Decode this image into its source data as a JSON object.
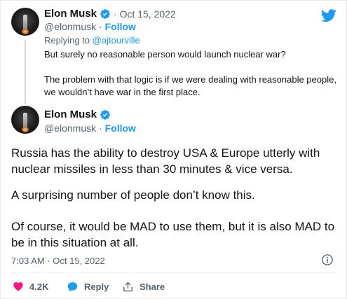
{
  "quoted_tweet": {
    "author_name": "Elon Musk",
    "date_sep": "·",
    "date": "Oct 15, 2022",
    "handle": "@elonmusk",
    "follow_sep": "·",
    "follow_label": "Follow",
    "replying_prefix": "Replying to",
    "replying_to": "@ajtourville",
    "paragraphs": [
      "But surely no reasonable person would launch nuclear war?",
      "The problem with that logic is if we were dealing with reasonable people, we wouldn’t have war in the first place."
    ]
  },
  "main_tweet": {
    "author_name": "Elon Musk",
    "handle": "@elonmusk",
    "follow_sep": "·",
    "follow_label": "Follow",
    "paragraphs": [
      "Russia has the ability to destroy USA & Europe utterly with nuclear missiles in less than 30 minutes & vice versa.",
      "A surprising number of people don’t know this.",
      "Of course, it would be MAD to use them, but it is also MAD to be in this situation at all."
    ],
    "timestamp": "7:03 AM · Oct 15, 2022"
  },
  "actions": {
    "like_count": "4.2K",
    "reply_label": "Reply",
    "share_label": "Share"
  },
  "icons": {
    "logo": "twitter-bird-icon",
    "verified": "verified-badge-icon",
    "info": "info-icon",
    "like": "heart-icon",
    "reply": "speech-bubble-icon",
    "share": "share-icon"
  },
  "colors": {
    "brand_blue": "#1d9bf0",
    "like_pink": "#f91880",
    "muted_text": "#536471",
    "primary_text": "#0f1419"
  }
}
